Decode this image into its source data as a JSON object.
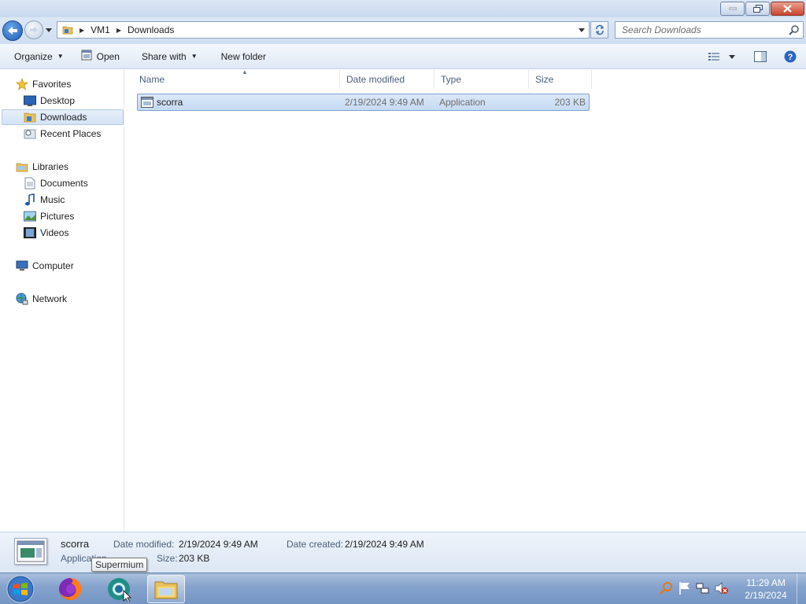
{
  "window": {
    "controls": {
      "minimize": "minimize",
      "restore": "restore",
      "close": "close"
    }
  },
  "address": {
    "crumbs": [
      "VM1",
      "Downloads"
    ],
    "search_placeholder": "Search Downloads"
  },
  "toolbar": {
    "organize": "Organize",
    "open": "Open",
    "share_with": "Share with",
    "new_folder": "New folder"
  },
  "nav": {
    "favorites": "Favorites",
    "desktop": "Desktop",
    "downloads": "Downloads",
    "recent_places": "Recent Places",
    "libraries": "Libraries",
    "documents": "Documents",
    "music": "Music",
    "pictures": "Pictures",
    "videos": "Videos",
    "computer": "Computer",
    "network": "Network"
  },
  "columns": {
    "name": "Name",
    "date_modified": "Date modified",
    "type": "Type",
    "size": "Size"
  },
  "files": [
    {
      "name": "scorra",
      "date_modified": "2/19/2024 9:49 AM",
      "type": "Application",
      "size": "203 KB"
    }
  ],
  "details": {
    "name": "scorra",
    "type": "Application",
    "date_modified_label": "Date modified:",
    "date_modified": "2/19/2024 9:49 AM",
    "date_created_label": "Date created:",
    "date_created": "2/19/2024 9:49 AM",
    "size_label": "Size:",
    "size": "203 KB"
  },
  "tooltip": "Supermium",
  "taskbar": {
    "time": "11:29 AM",
    "date": "2/19/2024"
  },
  "colors": {
    "selection": "#cde0f6",
    "taskbar": "#84a2cc",
    "accent": "#1c5bb5"
  }
}
